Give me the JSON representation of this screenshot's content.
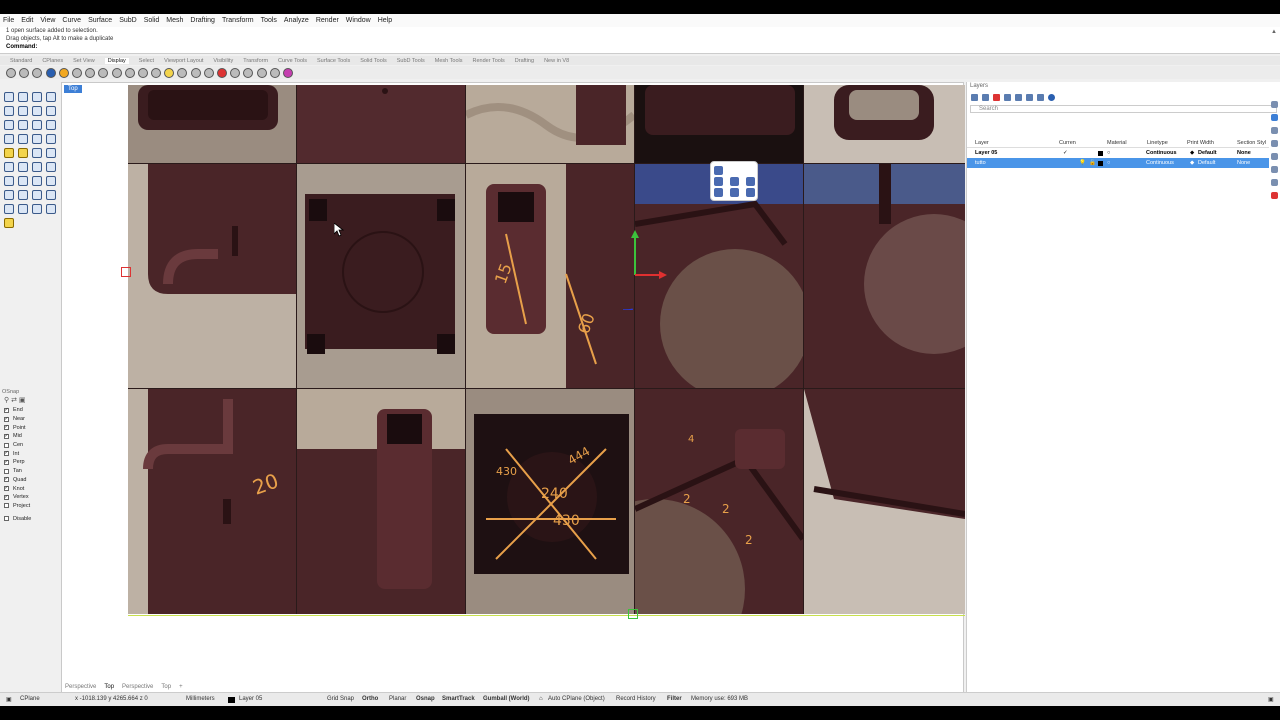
{
  "menu": [
    "File",
    "Edit",
    "View",
    "Curve",
    "Surface",
    "SubD",
    "Solid",
    "Mesh",
    "Drafting",
    "Transform",
    "Tools",
    "Analyze",
    "Render",
    "Window",
    "Help"
  ],
  "command_history": [
    "1 open surface added to selection.",
    "Drag objects, tap Alt to make a duplicate"
  ],
  "command_prompt": "Command:",
  "toolbar_tabs": [
    "Standard",
    "CPlanes",
    "Set View",
    "Display",
    "Select",
    "Viewport Layout",
    "Visibility",
    "Transform",
    "Curve Tools",
    "Surface Tools",
    "Solid Tools",
    "SubD Tools",
    "Mesh Tools",
    "Render Tools",
    "Drafting",
    "New in V8"
  ],
  "active_toolbar_tab": "Display",
  "viewport": {
    "label": "Top",
    "tabs": [
      "Perspective",
      "Top",
      "Perspective",
      "Top"
    ],
    "active_tab": "Top"
  },
  "osnap": {
    "title": "OSnap",
    "items": [
      {
        "label": "End",
        "checked": true
      },
      {
        "label": "Near",
        "checked": true
      },
      {
        "label": "Point",
        "checked": true
      },
      {
        "label": "Mid",
        "checked": true
      },
      {
        "label": "Cen",
        "checked": false
      },
      {
        "label": "Int",
        "checked": true
      },
      {
        "label": "Perp",
        "checked": true
      },
      {
        "label": "Tan",
        "checked": false
      },
      {
        "label": "Quad",
        "checked": true
      },
      {
        "label": "Knot",
        "checked": true
      },
      {
        "label": "Vertex",
        "checked": true
      },
      {
        "label": "Project",
        "checked": false
      }
    ],
    "disable_label": "Disable"
  },
  "layers": {
    "title": "Layers",
    "search_placeholder": "Search",
    "columns": [
      "Layer",
      "Curren",
      "Material",
      "Linetype",
      "Print Width",
      "Section Styl"
    ],
    "rows": [
      {
        "name": "Layer 05",
        "current": "✓",
        "linetype": "Continuous",
        "print_width": "Default",
        "section": "None",
        "selected": false
      },
      {
        "name": "tutto",
        "current": "",
        "linetype": "Continuous",
        "print_width": "Default",
        "section": "None",
        "selected": true
      }
    ]
  },
  "photo_annotations": {
    "tile_2_2": "15",
    "tile_2_2b": "60",
    "tile_3_1": "20",
    "tile_3_3": [
      "430",
      "444",
      "240",
      "430",
      "430"
    ],
    "tile_3_4": [
      "4",
      "2",
      "2",
      "2"
    ]
  },
  "status": {
    "cplane": "CPlane",
    "coords": "x -1018.139  y 4265.664  z 0",
    "units": "Millimeters",
    "layer": "Layer 05",
    "grid_snap": "Grid Snap",
    "ortho": "Ortho",
    "planar": "Planar",
    "osnap": "Osnap",
    "smarttrack": "SmartTrack",
    "gumball": "Gumball (World)",
    "auto_cplane": "Auto CPlane (Object)",
    "record_history": "Record History",
    "filter": "Filter",
    "memory": "Memory use: 693 MB"
  },
  "colors": {
    "accent": "#3d7fd6",
    "selection": "#4a95e8",
    "plastic": "#4a2528",
    "fabric": "#b8aa9a",
    "marker": "#e8a04a"
  }
}
